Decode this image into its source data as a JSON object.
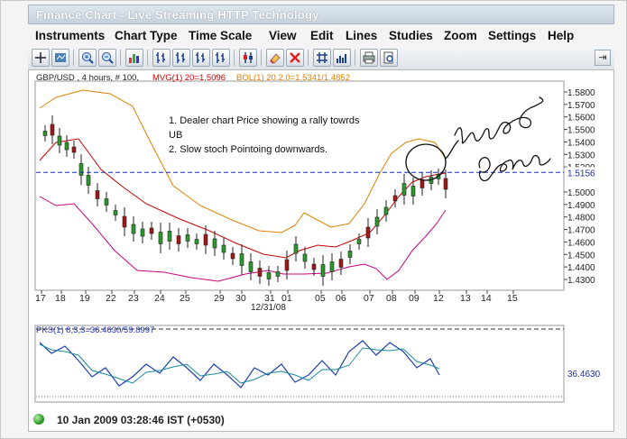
{
  "window": {
    "title": "Finance Chart - Live Streaming HTTP Technology"
  },
  "menu": [
    "Instruments",
    "Chart Type",
    "Time Scale",
    "View",
    "Edit",
    "Lines",
    "Studies",
    "Zoom",
    "Settings",
    "Help"
  ],
  "toolbar_icons": [
    "crosshair-icon",
    "instruments-icon",
    "zoom-in-icon",
    "zoom-out-icon",
    "bar-chart-icon",
    "candle-icon-1",
    "candle-icon-2",
    "candle-icon-3",
    "candle-icon-4",
    "candle-icon-5",
    "eraser-icon",
    "delete-icon",
    "grid-icon",
    "volume-icon",
    "print-icon",
    "print-preview-icon"
  ],
  "chart_header": {
    "symbol": "GBP/USD , 4 hours, # 100, ",
    "mvg": "MVG(1) 20=1.5096",
    "bol": "BOL(1) 20.2.0=1.5341/1.4852",
    "colors": {
      "mvg": "#cc0000",
      "bol": "#e08000"
    }
  },
  "annotation": {
    "line1": "1. Dealer chart Price showing a rally towrds",
    "line2": "UB",
    "line3": "2. Slow stoch Pointoing downwards."
  },
  "handwriting": "Engulfing candles",
  "price_axis": {
    "ticks": [
      "1.5800",
      "1.5700",
      "1.5600",
      "1.5500",
      "1.5400",
      "1.5300",
      "1.5200",
      "1.5000",
      "1.4900",
      "1.4800",
      "1.4700",
      "1.4600",
      "1.4500",
      "1.4400",
      "1.4300"
    ],
    "current_price": "1.5156"
  },
  "date_axis": {
    "labels": [
      "17",
      "18",
      "19",
      "22",
      "23",
      "24",
      "25",
      "29",
      "30",
      "31",
      "01",
      "05",
      "06",
      "07",
      "08",
      "09",
      "12",
      "13",
      "14",
      "15"
    ],
    "sublabel": "12/31/08"
  },
  "stoch": {
    "label": "PKS(1) 8,3,3=36.4630/59.8997",
    "value": "36.4630"
  },
  "status": {
    "text": "10 Jan 2009 03:28:46  IST (+0530)"
  }
}
